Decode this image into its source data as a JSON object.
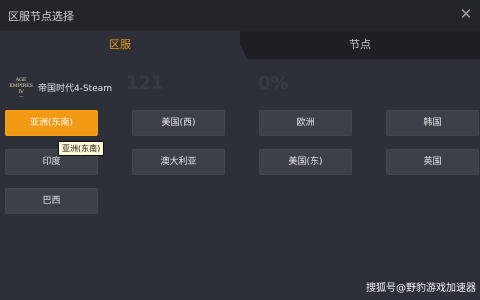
{
  "window": {
    "title": "区服节点选择"
  },
  "tabs": [
    {
      "label": "区服",
      "active": true
    },
    {
      "label": "节点",
      "active": false
    }
  ],
  "game": {
    "logo_lines": [
      "AGE",
      "EMPIRES",
      "IV",
      "—"
    ],
    "name": "帝国时代4-Steam"
  },
  "servers": [
    {
      "label": "亚洲(东南)",
      "selected": true
    },
    {
      "label": "美国(西)",
      "selected": false
    },
    {
      "label": "欧洲",
      "selected": false
    },
    {
      "label": "韩国",
      "selected": false
    },
    {
      "label": "印度",
      "selected": false
    },
    {
      "label": "澳大利亚",
      "selected": false
    },
    {
      "label": "美国(东)",
      "selected": false
    },
    {
      "label": "英国",
      "selected": false
    },
    {
      "label": "巴西",
      "selected": false
    }
  ],
  "tooltip": {
    "text": "亚洲(东南)"
  },
  "watermark": {
    "text": "搜狐号@野豹游戏加速器"
  },
  "background_numbers": [
    "121",
    "0%"
  ],
  "colors": {
    "accent": "#f39a14",
    "background": "#2d3038",
    "button": "#3d4048"
  },
  "icons": {
    "close": "close-icon"
  }
}
